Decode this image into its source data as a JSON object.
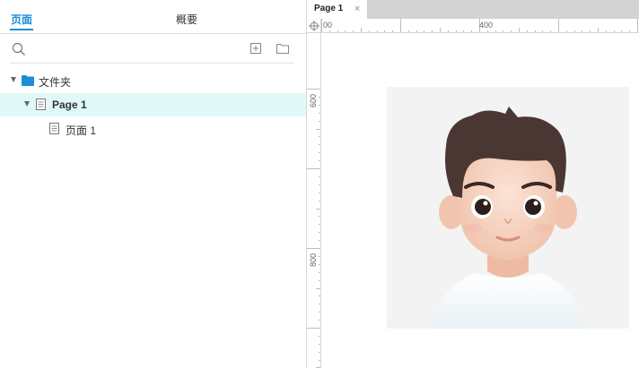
{
  "left_panel": {
    "tabs": [
      {
        "label": "页面",
        "active": true
      },
      {
        "label": "概要",
        "active": false
      }
    ],
    "toolbar": {
      "search_icon": "search-icon",
      "add_page_icon": "add-page-icon",
      "add_folder_icon": "add-folder-icon"
    },
    "tree": [
      {
        "label": "文件夹",
        "type": "folder",
        "expanded": true
      },
      {
        "label": "Page 1",
        "type": "page",
        "expanded": true,
        "selected": true
      },
      {
        "label": "页面 1",
        "type": "page",
        "selected": false
      }
    ]
  },
  "right_panel": {
    "document_tab": {
      "label": "Page 1",
      "close": "×"
    },
    "ruler": {
      "horizontal_labels": [
        "00",
        "400"
      ],
      "vertical_labels": [
        "600",
        "800"
      ]
    },
    "canvas": {
      "image": "avatar-illustration"
    }
  },
  "colors": {
    "accent": "#1a8fd6",
    "selected_row": "#e0f8f8",
    "folder": "#1a8fd6",
    "tab_strip": "#d3d3d3"
  }
}
